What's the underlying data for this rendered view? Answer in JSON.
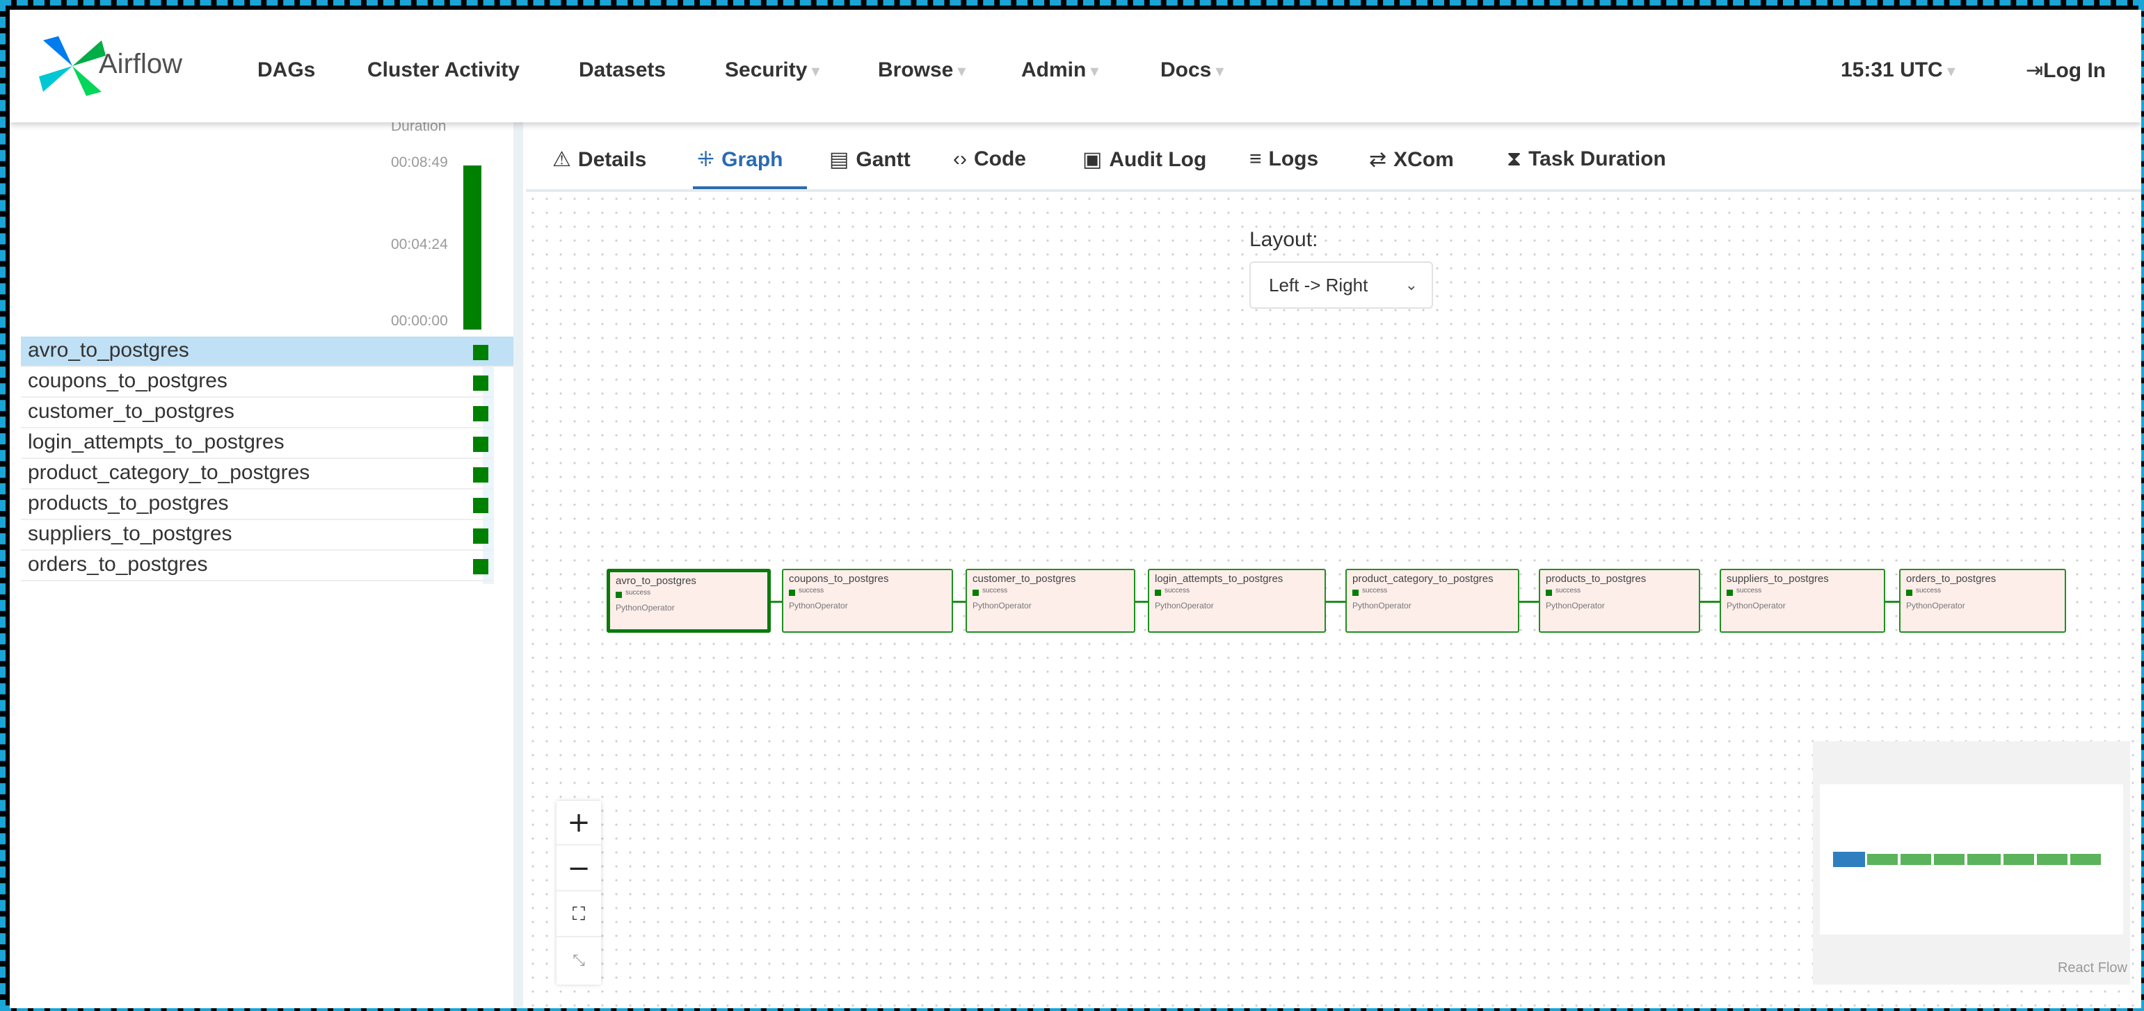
{
  "navbar": {
    "brand": "Airflow",
    "items": [
      {
        "label": "DAGs"
      },
      {
        "label": "Cluster Activity"
      },
      {
        "label": "Datasets"
      },
      {
        "label": "Security"
      },
      {
        "label": "Browse"
      },
      {
        "label": "Admin"
      },
      {
        "label": "Docs"
      }
    ],
    "time": "15:31 UTC",
    "login": "Log In"
  },
  "grid": {
    "duration_header": "Duration",
    "duration_ticks": [
      "00:08:49",
      "00:04:24",
      "00:00:00"
    ],
    "run_duration_fraction": 1.0,
    "tasks": [
      {
        "name": "avro_to_postgres"
      },
      {
        "name": "coupons_to_postgres"
      },
      {
        "name": "customer_to_postgres"
      },
      {
        "name": "login_attempts_to_postgres"
      },
      {
        "name": "product_category_to_postgres"
      },
      {
        "name": "products_to_postgres"
      },
      {
        "name": "suppliers_to_postgres"
      },
      {
        "name": "orders_to_postgres"
      }
    ]
  },
  "tabs": [
    {
      "label": "Details",
      "icon": "warning-triangle-icon"
    },
    {
      "label": "Graph",
      "icon": "graph-icon"
    },
    {
      "label": "Gantt",
      "icon": "gantt-icon"
    },
    {
      "label": "Code",
      "icon": "code-icon"
    },
    {
      "label": "Audit Log",
      "icon": "audit-log-icon"
    },
    {
      "label": "Logs",
      "icon": "logs-icon"
    },
    {
      "label": "XCom",
      "icon": "xcom-icon"
    },
    {
      "label": "Task Duration",
      "icon": "hourglass-icon"
    }
  ],
  "graph": {
    "layout_label": "Layout:",
    "layout_value": "Left -> Right",
    "nodes": [
      {
        "name": "avro_to_postgres",
        "status": "success",
        "operator": "PythonOperator"
      },
      {
        "name": "coupons_to_postgres",
        "status": "success",
        "operator": "PythonOperator"
      },
      {
        "name": "customer_to_postgres",
        "status": "success",
        "operator": "PythonOperator"
      },
      {
        "name": "login_attempts_to_postgres",
        "status": "success",
        "operator": "PythonOperator"
      },
      {
        "name": "product_category_to_postgres",
        "status": "success",
        "operator": "PythonOperator"
      },
      {
        "name": "products_to_postgres",
        "status": "success",
        "operator": "PythonOperator"
      },
      {
        "name": "suppliers_to_postgres",
        "status": "success",
        "operator": "PythonOperator"
      },
      {
        "name": "orders_to_postgres",
        "status": "success",
        "operator": "PythonOperator"
      }
    ],
    "controls": {
      "zoom_in": "+",
      "zoom_out": "−",
      "fit": "⛶",
      "lock": "⤡"
    },
    "attribution": "React Flow"
  },
  "colors": {
    "success": "#008000",
    "accent": "#2a6bb0",
    "node_bg": "#fdeeea",
    "selected_row": "#bfe0f5"
  }
}
